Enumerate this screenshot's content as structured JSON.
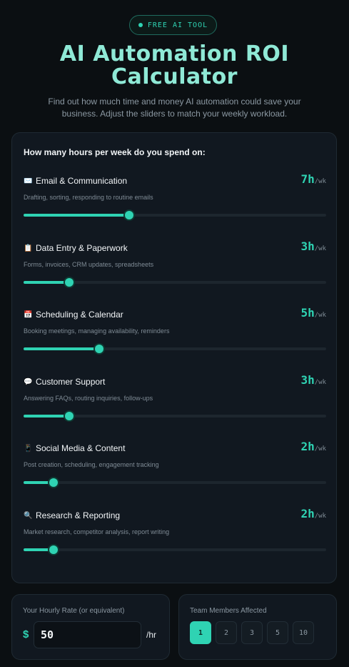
{
  "badge": {
    "label": "FREE AI TOOL"
  },
  "header": {
    "title_line1": "AI Automation ROI",
    "title_line2": "Calculator",
    "subtitle_line1": "Find out how much time and money AI automation could save your",
    "subtitle_line2": "business. Adjust the sliders to match your weekly workload."
  },
  "hours_section": {
    "title": "How many hours per week do you spend on:",
    "unit_label": "/wk",
    "tasks": [
      {
        "icon": "envelope-icon",
        "emoji": "✉️",
        "name": "Email & Communication",
        "desc": "Drafting, sorting, responding to routine emails",
        "hours_label": "7h",
        "fraction": 0.35
      },
      {
        "icon": "clipboard-icon",
        "emoji": "📋",
        "name": "Data Entry & Paperwork",
        "desc": "Forms, invoices, CRM updates, spreadsheets",
        "hours_label": "3h",
        "fraction": 0.15
      },
      {
        "icon": "calendar-icon",
        "emoji": "📅",
        "name": "Scheduling & Calendar",
        "desc": "Booking meetings, managing availability, reminders",
        "hours_label": "5h",
        "fraction": 0.25
      },
      {
        "icon": "speech-bubble-icon",
        "emoji": "💬",
        "name": "Customer Support",
        "desc": "Answering FAQs, routing inquiries, follow-ups",
        "hours_label": "3h",
        "fraction": 0.15
      },
      {
        "icon": "phone-icon",
        "emoji": "📱",
        "name": "Social Media & Content",
        "desc": "Post creation, scheduling, engagement tracking",
        "hours_label": "2h",
        "fraction": 0.1
      },
      {
        "icon": "magnifier-icon",
        "emoji": "🔍",
        "name": "Research & Reporting",
        "desc": "Market research, competitor analysis, report writing",
        "hours_label": "2h",
        "fraction": 0.1
      }
    ]
  },
  "rate": {
    "label": "Your Hourly Rate (or equivalent)",
    "currency": "$",
    "value": "50",
    "suffix": "/hr"
  },
  "team": {
    "label": "Team Members Affected",
    "options": [
      "1",
      "2",
      "3",
      "5",
      "10"
    ],
    "selected": "1"
  },
  "colors": {
    "accent": "#2fd3b3",
    "title": "#8fe9d6",
    "background": "#0b0f12",
    "card": "#111820"
  }
}
